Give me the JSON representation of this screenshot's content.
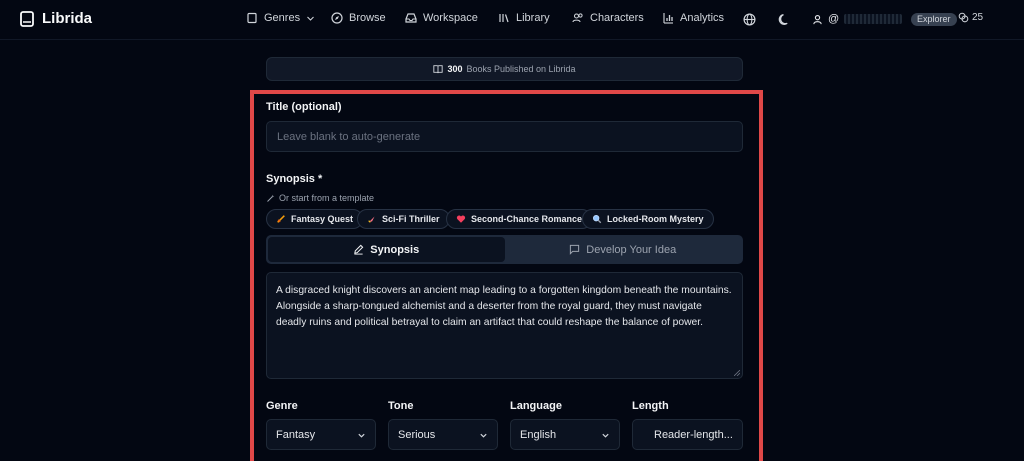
{
  "nav": {
    "brand": "Librida",
    "genres": "Genres",
    "browse": "Browse",
    "workspace": "Workspace",
    "library": "Library",
    "characters": "Characters",
    "analytics": "Analytics",
    "user_prefix": "@",
    "badge": "Explorer",
    "credits": "25"
  },
  "banner": {
    "count": "300",
    "text": "Books Published on Librida"
  },
  "form": {
    "title_label": "Title (optional)",
    "title_placeholder": "Leave blank to auto-generate",
    "synopsis_label": "Synopsis *",
    "template_hint": "Or start from a template",
    "templates": [
      {
        "label": "Fantasy Quest",
        "icon": "sword-icon"
      },
      {
        "label": "Sci-Fi Thriller",
        "icon": "rocket-icon"
      },
      {
        "label": "Second-Chance Romance",
        "icon": "heart-icon"
      },
      {
        "label": "Locked-Room Mystery",
        "icon": "magnifier-icon"
      }
    ],
    "tabs": {
      "synopsis": "Synopsis",
      "develop": "Develop Your Idea"
    },
    "synopsis_text": "A disgraced knight discovers an ancient map leading to a forgotten kingdom beneath the mountains. Alongside a sharp-tongued alchemist and a deserter from the royal guard, they must navigate deadly ruins and political betrayal to claim an artifact that could reshape the balance of power.",
    "genre_label": "Genre",
    "genre_value": "Fantasy",
    "tone_label": "Tone",
    "tone_value": "Serious",
    "language_label": "Language",
    "language_value": "English",
    "length_label": "Length",
    "length_value": "Reader-length..."
  },
  "colors": {
    "background": "#030712",
    "highlight": "#e04848",
    "surface": "#0b1220"
  }
}
